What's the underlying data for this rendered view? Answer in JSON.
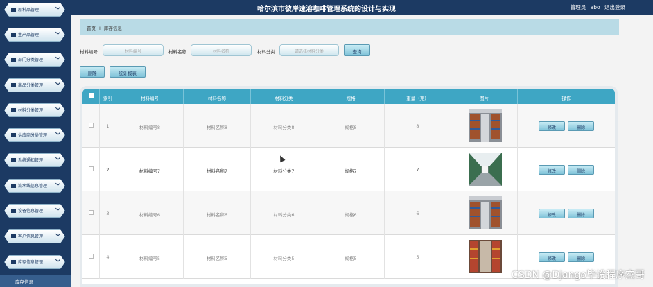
{
  "header": {
    "title": "哈尔滨市彼岸速溶咖啡管理系统的设计与实现",
    "role": "管理员",
    "username": "abo",
    "logout": "退出登录"
  },
  "sidebar": {
    "items": [
      {
        "label": "原料品管理",
        "icon": "monitor-icon"
      },
      {
        "label": "生产品管理",
        "icon": "tools-icon"
      },
      {
        "label": "部门分类管理",
        "icon": "grid-icon"
      },
      {
        "label": "商品分类管理",
        "icon": "document-icon"
      },
      {
        "label": "材料分类管理",
        "icon": "grid-icon"
      },
      {
        "label": "供应商分类管理",
        "icon": "list-icon"
      },
      {
        "label": "系统通知管理",
        "icon": "clipboard-icon"
      },
      {
        "label": "流水线信息管理",
        "icon": "grid-icon"
      },
      {
        "label": "设备信息管理",
        "icon": "flag-icon"
      },
      {
        "label": "客户信息管理",
        "icon": "monitor-icon"
      },
      {
        "label": "库存信息管理",
        "icon": "grid-icon"
      }
    ],
    "active_sub": "库存信息"
  },
  "breadcrumb": {
    "home": "首页",
    "separator": "Ⅰ",
    "current": "库存信息"
  },
  "search": {
    "code_label": "材料编号",
    "code_placeholder": "材料编号",
    "name_label": "材料名称",
    "name_placeholder": "材料名称",
    "category_label": "材料分类",
    "category_placeholder": "请选择材料分类",
    "query_button": "查询"
  },
  "actions": {
    "delete_button": "删除",
    "report_button": "统计报表"
  },
  "table": {
    "columns": [
      "索引",
      "材料编号",
      "材料名称",
      "材料分类",
      "规格",
      "重量（克）",
      "图片",
      "操作"
    ],
    "rows": [
      {
        "index": "1",
        "code": "材料编号8",
        "name": "材料名称8",
        "category": "材料分类8",
        "spec": "规格8",
        "weight": "8"
      },
      {
        "index": "2",
        "code": "材料编号7",
        "name": "材料名称7",
        "category": "材料分类7",
        "spec": "规格7",
        "weight": "7"
      },
      {
        "index": "3",
        "code": "材料编号6",
        "name": "材料名称6",
        "category": "材料分类6",
        "spec": "规格6",
        "weight": "6"
      },
      {
        "index": "4",
        "code": "材料编号5",
        "name": "材料名称5",
        "category": "材料分类5",
        "spec": "规格5",
        "weight": "5"
      }
    ],
    "edit_button": "修改",
    "delete_button": "删除"
  },
  "watermark": "CSDN @Django毕设程序杰哥"
}
